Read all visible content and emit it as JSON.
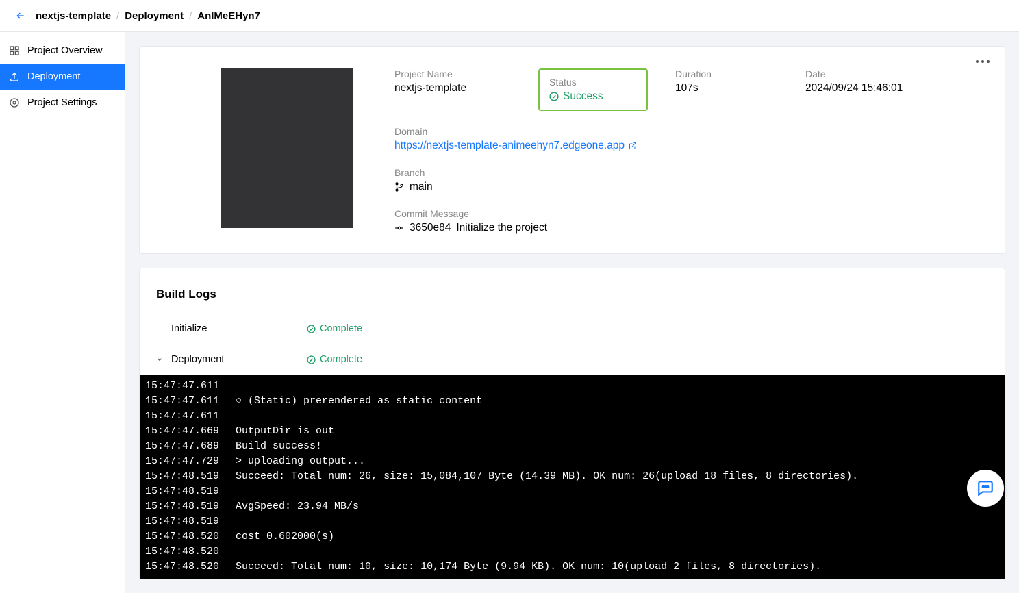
{
  "breadcrumb": {
    "a": "nextjs-template",
    "b": "Deployment",
    "c": "AnIMeEHyn7"
  },
  "sidebar": {
    "overview": "Project Overview",
    "deployment": "Deployment",
    "settings": "Project Settings"
  },
  "info": {
    "project_name_label": "Project Name",
    "project_name": "nextjs-template",
    "status_label": "Status",
    "status": "Success",
    "duration_label": "Duration",
    "duration": "107s",
    "date_label": "Date",
    "date": "2024/09/24 15:46:01",
    "domain_label": "Domain",
    "domain": "https://nextjs-template-animeehyn7.edgeone.app",
    "branch_label": "Branch",
    "branch": "main",
    "commit_label": "Commit Message",
    "commit_hash": "3650e84",
    "commit_msg": "Initialize the project"
  },
  "logs": {
    "title": "Build Logs",
    "step1": "Initialize",
    "step2": "Deployment",
    "complete": "Complete"
  },
  "terminal": [
    {
      "ts": "15:47:47.611",
      "txt": ""
    },
    {
      "ts": "15:47:47.611",
      "txt": "○ (Static) prerendered as static content"
    },
    {
      "ts": "15:47:47.611",
      "txt": ""
    },
    {
      "ts": "15:47:47.669",
      "txt": "OutputDir is out"
    },
    {
      "ts": "15:47:47.689",
      "txt": "Build success!"
    },
    {
      "ts": "15:47:47.729",
      "txt": "> uploading output..."
    },
    {
      "ts": "15:47:48.519",
      "txt": "Succeed: Total num: 26, size: 15,084,107 Byte (14.39 MB). OK num: 26(upload 18 files, 8 directories)."
    },
    {
      "ts": "15:47:48.519",
      "txt": ""
    },
    {
      "ts": "15:47:48.519",
      "txt": "AvgSpeed: 23.94 MB/s"
    },
    {
      "ts": "15:47:48.519",
      "txt": ""
    },
    {
      "ts": "15:47:48.520",
      "txt": "cost 0.602000(s)"
    },
    {
      "ts": "15:47:48.520",
      "txt": ""
    },
    {
      "ts": "15:47:48.520",
      "txt": "Succeed: Total num: 10, size: 10,174 Byte (9.94 KB). OK num: 10(upload 2 files, 8 directories)."
    }
  ]
}
